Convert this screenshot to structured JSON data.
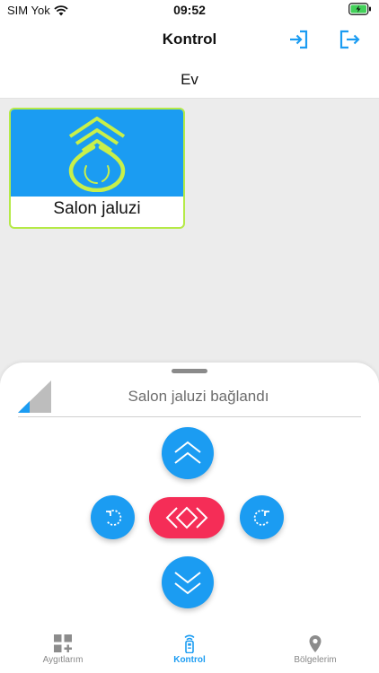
{
  "status_bar": {
    "carrier": "SIM Yok",
    "time": "09:52"
  },
  "header": {
    "title": "Kontrol"
  },
  "location": {
    "name": "Ev"
  },
  "devices": [
    {
      "label": "Salon jaluzi"
    }
  ],
  "control_sheet": {
    "status_text": "Salon jaluzi bağlandı"
  },
  "tabs": [
    {
      "label": "Aygıtlarım",
      "icon": "grid-plus-icon",
      "active": false
    },
    {
      "label": "Kontrol",
      "icon": "remote-control-icon",
      "active": true
    },
    {
      "label": "Bölgelerim",
      "icon": "location-pin-icon",
      "active": false
    }
  ],
  "colors": {
    "accent": "#1b9cf2",
    "stop": "#f52d57",
    "device_border": "#b5ea47",
    "device_icon": "#c8f04a",
    "battery": "#43d15a"
  }
}
